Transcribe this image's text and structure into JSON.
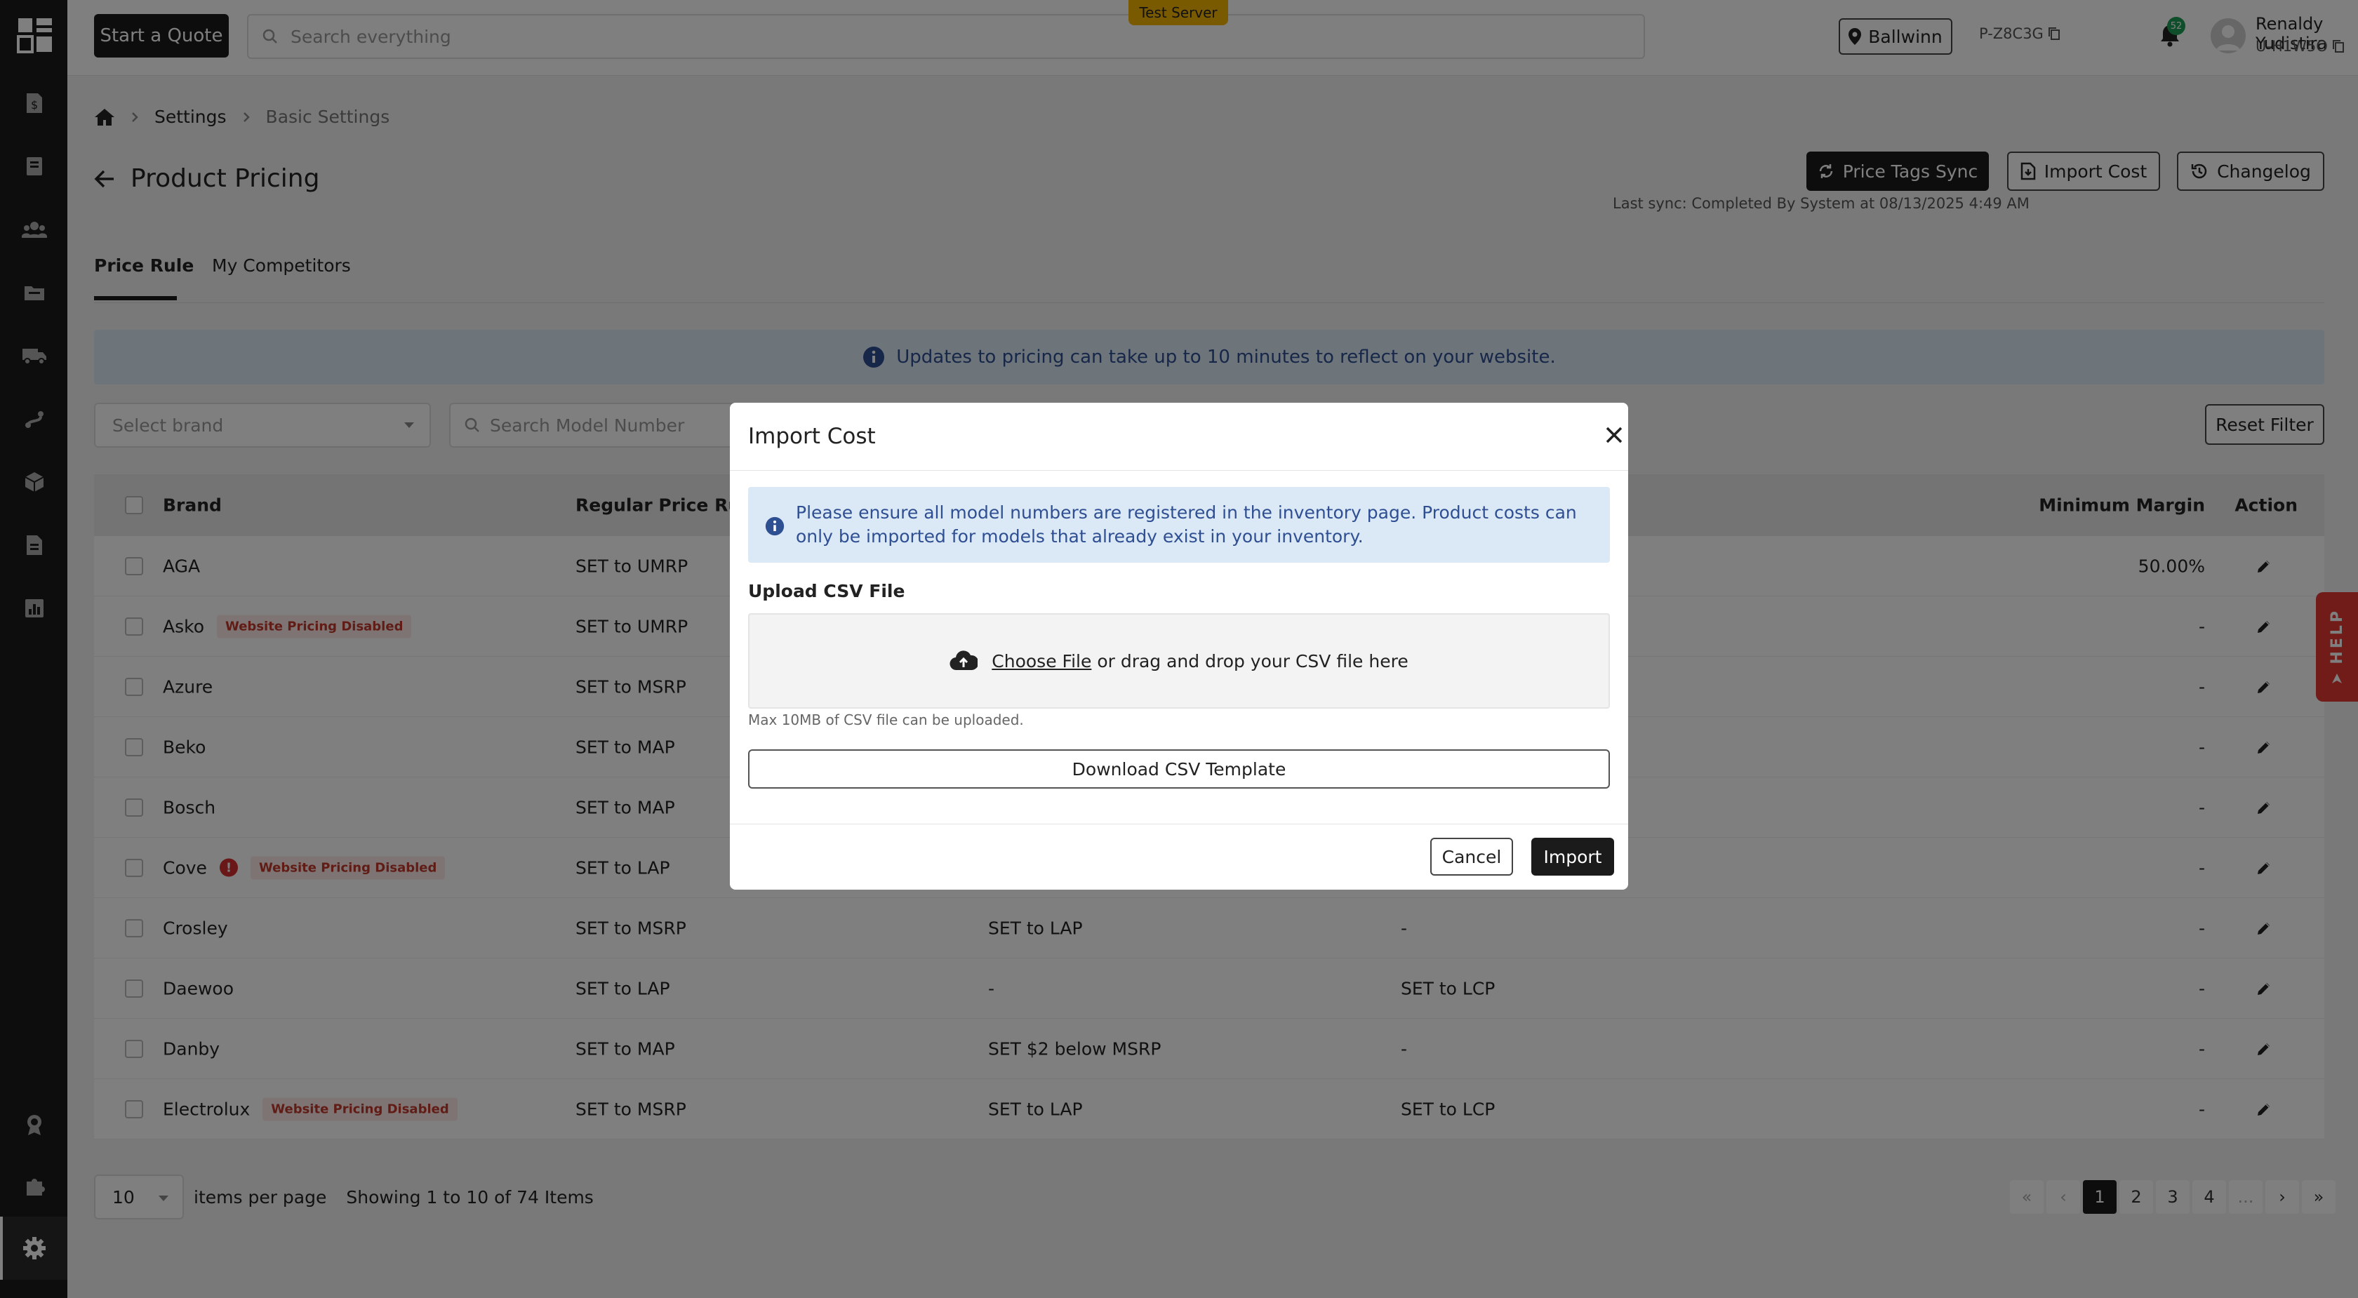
{
  "topbar": {
    "quote_button": "Start a Quote",
    "search_placeholder": "Search everything",
    "server_badge": "Test Server",
    "location": "Ballwinn",
    "store_id": "P-Z8C3G",
    "notification_count": "52",
    "user_name": "Renaldy Yudistira",
    "user_id": "U-H1W5O"
  },
  "breadcrumb": {
    "settings": "Settings",
    "current": "Basic Settings"
  },
  "page": {
    "title": "Product Pricing",
    "price_tags_sync": "Price Tags Sync",
    "import_cost": "Import Cost",
    "changelog": "Changelog",
    "last_sync": "Last sync: Completed By System at 08/13/2025 4:49 AM"
  },
  "tabs": [
    "Price Rule",
    "My Competitors"
  ],
  "banner": "Updates to pricing can take up to 10 minutes to reflect on your website.",
  "filters": {
    "brand_placeholder": "Select brand",
    "model_placeholder": "Search Model Number",
    "reset": "Reset Filter"
  },
  "table": {
    "headers": {
      "brand": "Brand",
      "regular": "Regular Price Rule",
      "min_margin": "Minimum Margin",
      "action": "Action"
    },
    "disabled_badge": "Website Pricing Disabled",
    "rows": [
      {
        "brand": "AGA",
        "disabled": false,
        "warn": false,
        "regular": "SET to UMRP",
        "col3": "",
        "col4": "",
        "margin": "50.00%"
      },
      {
        "brand": "Asko",
        "disabled": true,
        "warn": false,
        "regular": "SET to UMRP",
        "col3": "",
        "col4": "",
        "margin": "-"
      },
      {
        "brand": "Azure",
        "disabled": false,
        "warn": false,
        "regular": "SET to MSRP",
        "col3": "",
        "col4": "",
        "margin": "-"
      },
      {
        "brand": "Beko",
        "disabled": false,
        "warn": false,
        "regular": "SET to MAP",
        "col3": "",
        "col4": "",
        "margin": "-"
      },
      {
        "brand": "Bosch",
        "disabled": false,
        "warn": false,
        "regular": "SET to MAP",
        "col3": "",
        "col4": "",
        "margin": "-"
      },
      {
        "brand": "Cove",
        "disabled": true,
        "warn": true,
        "regular": "SET to LAP",
        "col3": "",
        "col4": "",
        "margin": "-"
      },
      {
        "brand": "Crosley",
        "disabled": false,
        "warn": false,
        "regular": "SET to MSRP",
        "col3": "SET to LAP",
        "col4": "-",
        "margin": "-"
      },
      {
        "brand": "Daewoo",
        "disabled": false,
        "warn": false,
        "regular": "SET to LAP",
        "col3": "-",
        "col4": "SET to LCP",
        "margin": "-"
      },
      {
        "brand": "Danby",
        "disabled": false,
        "warn": false,
        "regular": "SET to MAP",
        "col3": "SET $2 below MSRP",
        "col4": "-",
        "margin": "-"
      },
      {
        "brand": "Electrolux",
        "disabled": true,
        "warn": false,
        "regular": "SET to MSRP",
        "col3": "SET to LAP",
        "col4": "SET to LCP",
        "margin": "-"
      }
    ]
  },
  "pagination": {
    "per_page": "10",
    "per_page_label": "items per page",
    "showing": "Showing 1 to 10 of 74 Items",
    "first": "«",
    "prev": "‹",
    "next": "›",
    "last": "»",
    "pages": [
      "1",
      "2",
      "3",
      "4",
      "..."
    ]
  },
  "help": "HELP",
  "modal": {
    "title": "Import Cost",
    "info": "Please ensure all model numbers are registered in the inventory page. Product costs can only be imported for models that already exist in your inventory.",
    "upload_label": "Upload CSV File",
    "choose_file": "Choose File",
    "drop_text": "or drag and drop your CSV file here",
    "max_note": "Max 10MB of CSV file can be uploaded.",
    "download_template": "Download CSV Template",
    "cancel": "Cancel",
    "import": "Import"
  },
  "colors": {
    "dark": "#1b1b1b",
    "info_bg": "#dbe8f5",
    "info_text": "#2f4f93",
    "danger": "#e53935",
    "badge_green": "#1f9d55",
    "server_badge": "#f5b400"
  }
}
